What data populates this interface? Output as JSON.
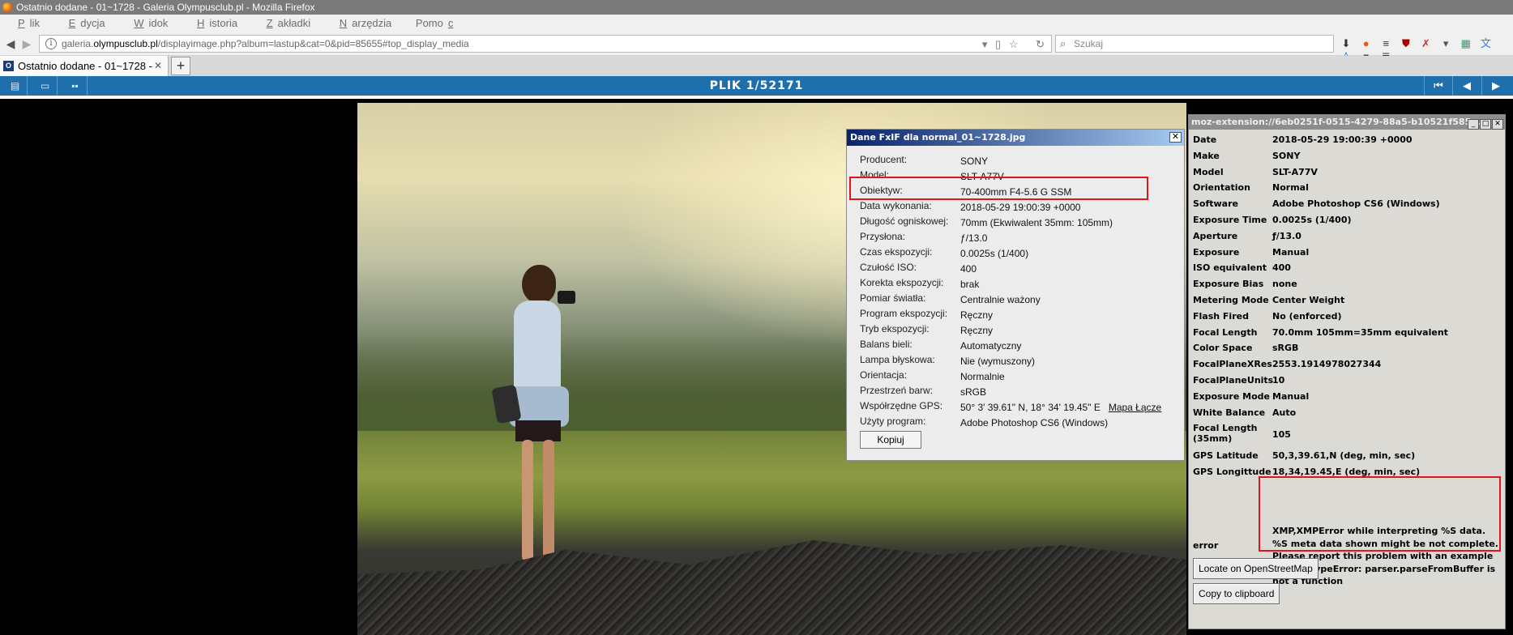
{
  "window": {
    "title": "Ostatnio dodane - 01~1728 - Galeria Olympusclub.pl - Mozilla Firefox"
  },
  "menu": [
    {
      "pre": "",
      "u": "P",
      "post": "lik"
    },
    {
      "pre": "",
      "u": "E",
      "post": "dycja"
    },
    {
      "pre": "",
      "u": "W",
      "post": "idok"
    },
    {
      "pre": "",
      "u": "H",
      "post": "istoria"
    },
    {
      "pre": "",
      "u": "Z",
      "post": "akładki"
    },
    {
      "pre": "",
      "u": "N",
      "post": "arzędzia"
    },
    {
      "pre": "Pomo",
      "u": "c",
      "post": ""
    }
  ],
  "url": {
    "pre": "galeria.",
    "host": "olympusclub.pl",
    "path": "/displayimage.php?album=lastup&cat=0&pid=85655#top_display_media"
  },
  "search": {
    "placeholder": "Szukaj"
  },
  "tab": {
    "title": "Ostatnio dodane - 01~1728 -",
    "favicon": "O"
  },
  "gallery": {
    "title": "PLIK 1/52171"
  },
  "fxif": {
    "title": "Dane FxIF dla normal_01~1728.jpg",
    "rows": [
      {
        "label": "Producent:",
        "value": "SONY"
      },
      {
        "label": "Model:",
        "value": "SLT-A77V"
      },
      {
        "label": "Obiektyw:",
        "value": "70-400mm F4-5.6 G SSM"
      },
      {
        "label": "Data wykonania:",
        "value": "2018-05-29 19:00:39 +0000"
      },
      {
        "label": "Długość ogniskowej:",
        "value": "70mm (Ekwiwalent 35mm: 105mm)"
      },
      {
        "label": "Przysłona:",
        "value": "ƒ/13.0"
      },
      {
        "label": "Czas ekspozycji:",
        "value": "0.0025s (1/400)"
      },
      {
        "label": "Czułość ISO:",
        "value": "400"
      },
      {
        "label": "Korekta ekspozycji:",
        "value": "brak"
      },
      {
        "label": "Pomiar światła:",
        "value": "Centralnie ważony"
      },
      {
        "label": "Program ekspozycji:",
        "value": "Ręczny"
      },
      {
        "label": "Tryb ekspozycji:",
        "value": "Ręczny"
      },
      {
        "label": "Balans bieli:",
        "value": "Automatyczny"
      },
      {
        "label": "Lampa błyskowa:",
        "value": "Nie (wymuszony)"
      },
      {
        "label": "Orientacja:",
        "value": "Normalnie"
      },
      {
        "label": "Przestrzeń barw:",
        "value": "sRGB"
      },
      {
        "label": "Współrzędne GPS:",
        "value": "50° 3' 39.61\" N, 18° 34' 19.45\" E"
      },
      {
        "label": "Użyty program:",
        "value": "Adobe Photoshop CS6 (Windows)"
      }
    ],
    "map_link": "Mapa Łącze",
    "copy_button": "Kopiuj"
  },
  "ext": {
    "title": "moz-extension://6eb0251f-0515-4279-88a5-b10521f585...",
    "rows": [
      {
        "k": "Date",
        "v": "2018-05-29 19:00:39 +0000"
      },
      {
        "k": "Make",
        "v": "SONY"
      },
      {
        "k": "Model",
        "v": "SLT-A77V"
      },
      {
        "k": "Orientation",
        "v": "Normal"
      },
      {
        "k": "Software",
        "v": "Adobe Photoshop CS6 (Windows)"
      },
      {
        "k": "Exposure Time",
        "v": "0.0025s (1/400)"
      },
      {
        "k": "Aperture",
        "v": "ƒ/13.0"
      },
      {
        "k": "Exposure",
        "v": "Manual"
      },
      {
        "k": "ISO equivalent",
        "v": "400"
      },
      {
        "k": "Exposure Bias",
        "v": "none"
      },
      {
        "k": "Metering Mode",
        "v": "Center Weight"
      },
      {
        "k": "Flash Fired",
        "v": "No (enforced)"
      },
      {
        "k": "Focal Length",
        "v": "70.0mm 105mm=35mm equivalent"
      },
      {
        "k": "Color Space",
        "v": "sRGB"
      },
      {
        "k": "FocalPlaneXRes",
        "v": "2553.1914978027344"
      },
      {
        "k": "FocalPlaneUnits",
        "v": "10"
      },
      {
        "k": "Exposure Mode",
        "v": "Manual"
      },
      {
        "k": "White Balance",
        "v": "Auto"
      },
      {
        "k": "Focal Length (35mm)",
        "v": "105"
      },
      {
        "k": "GPS Latitude",
        "v": "50,3,39.61,N (deg, min, sec)"
      },
      {
        "k": "GPS Longittude",
        "v": "18,34,19.45,E (deg, min, sec)"
      }
    ],
    "error_key": "error",
    "error_value": "XMP,XMPError while interpreting %S data. %S meta data shown might be not complete. Please report this problem with an example image. TypeError: parser.parseFromBuffer is not a function",
    "osm_button": "Locate on OpenStreetMap",
    "clipboard_button": "Copy to clipboard"
  },
  "colors": {
    "accent": "#1e6fab",
    "highlight_box": "#e0151d",
    "dialog_title": "#0a246a"
  }
}
